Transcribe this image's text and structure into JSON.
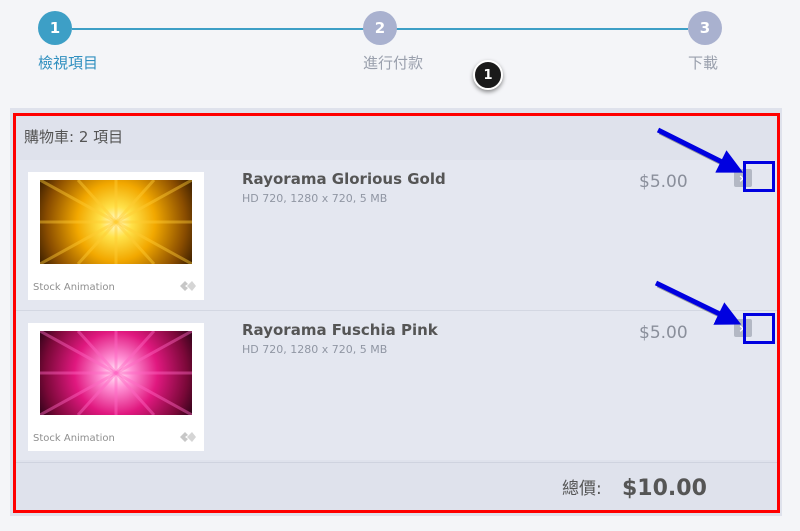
{
  "stepper": {
    "steps": [
      {
        "number": "1",
        "label": "檢視項目",
        "state": "active"
      },
      {
        "number": "2",
        "label": "進行付款",
        "state": "inactive"
      },
      {
        "number": "3",
        "label": "下載",
        "state": "inactive"
      }
    ],
    "active_color": "#3d9fc6",
    "inactive_color": "#a9b1cf"
  },
  "annotation": {
    "marker": "1"
  },
  "cart": {
    "header": "購物車: 2 項目",
    "items": [
      {
        "title": "Rayorama Glorious Gold",
        "meta": "HD 720, 1280 x 720, 5 MB",
        "price": "$5.00",
        "thumb_caption": "Stock Animation",
        "remove_label": "×"
      },
      {
        "title": "Rayorama Fuschia Pink",
        "meta": "HD 720, 1280 x 720, 5 MB",
        "price": "$5.00",
        "thumb_caption": "Stock Animation",
        "remove_label": "×"
      }
    ],
    "total_label": "總價:",
    "total_value": "$10.00"
  },
  "colors": {
    "highlight_red": "#ff0000",
    "highlight_blue": "#0000e0"
  }
}
